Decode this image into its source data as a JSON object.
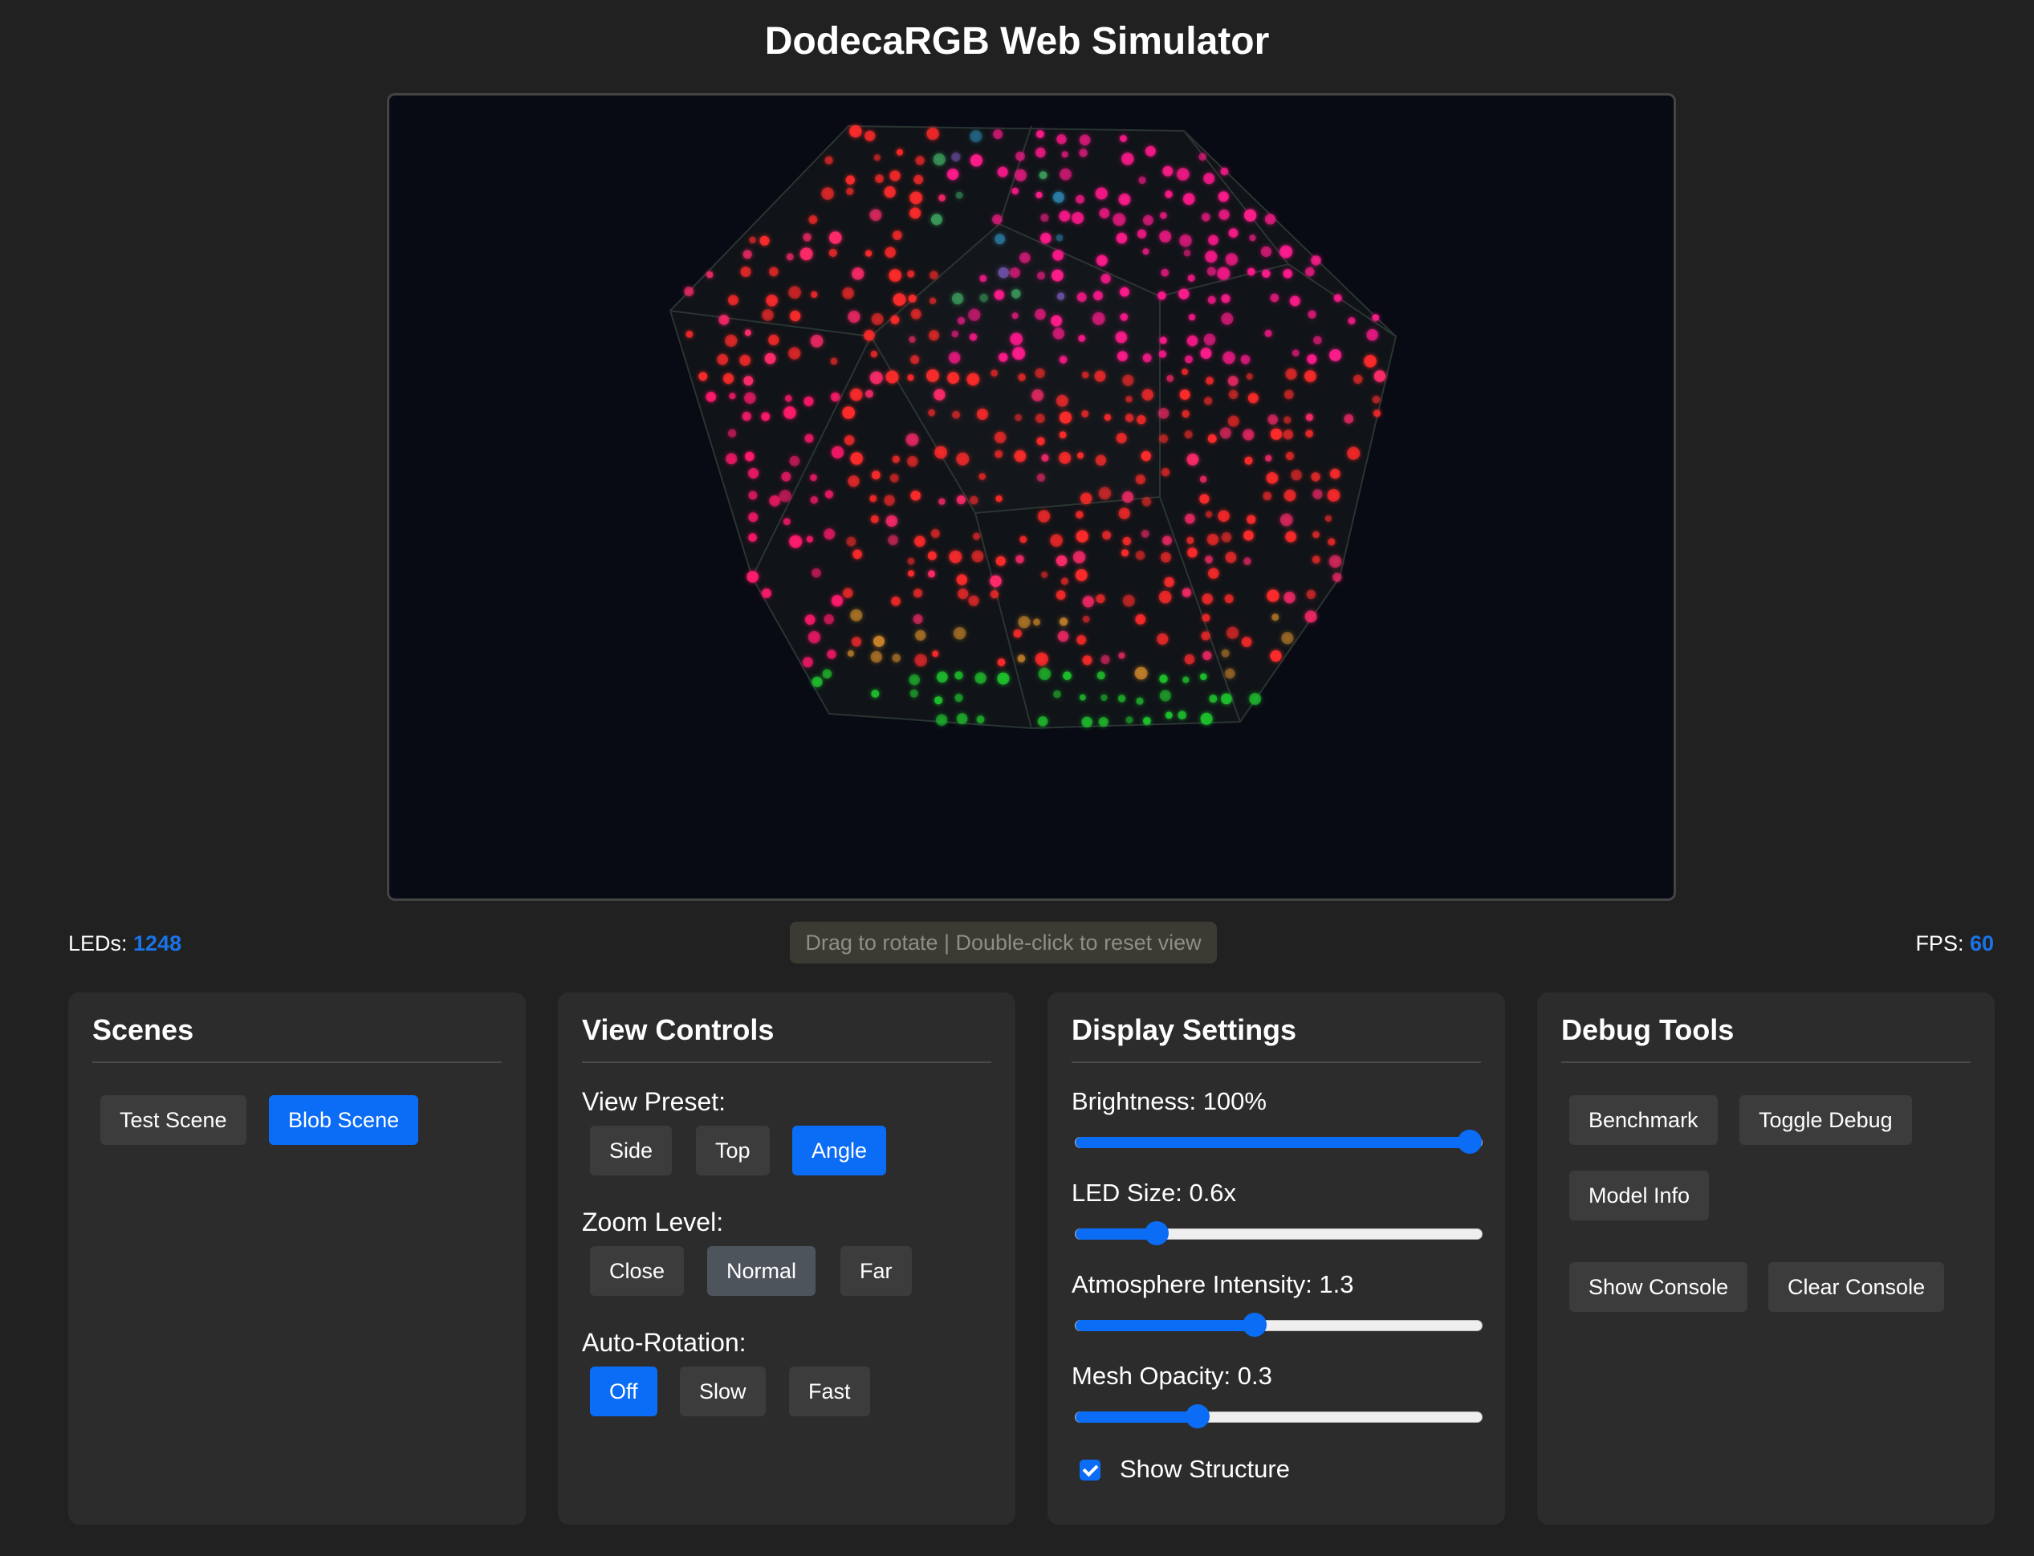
{
  "app": {
    "title": "DodecaRGB Web Simulator"
  },
  "stats": {
    "leds_label": "LEDs: ",
    "leds_value": "1248",
    "fps_label": "FPS: ",
    "fps_value": "60",
    "hint": "Drag to rotate | Double-click to reset view"
  },
  "colors": {
    "accent": "#0b6cf5",
    "stat_value": "#1a73e8",
    "page_bg": "#212121",
    "panel_bg": "#2c2c2c",
    "viewport_bg": "#080a14"
  },
  "scenes": {
    "title": "Scenes",
    "buttons": [
      {
        "label": "Test Scene",
        "active": false
      },
      {
        "label": "Blob Scene",
        "active": true
      }
    ]
  },
  "view_controls": {
    "title": "View Controls",
    "preset_label": "View Preset:",
    "presets": [
      {
        "label": "Side",
        "active": false
      },
      {
        "label": "Top",
        "active": false
      },
      {
        "label": "Angle",
        "active": true
      }
    ],
    "zoom_label": "Zoom Level:",
    "zoom": [
      {
        "label": "Close",
        "active": false
      },
      {
        "label": "Normal",
        "selected": true
      },
      {
        "label": "Far",
        "active": false
      }
    ],
    "rotation_label": "Auto-Rotation:",
    "rotation": [
      {
        "label": "Off",
        "active": true
      },
      {
        "label": "Slow",
        "active": false
      },
      {
        "label": "Fast",
        "active": false
      }
    ]
  },
  "display_settings": {
    "title": "Display Settings",
    "brightness": {
      "label": "Brightness: 100%",
      "value": 1.0
    },
    "led_size": {
      "label": "LED Size: 0.6x",
      "value": 0.2
    },
    "atmosphere": {
      "label": "Atmosphere Intensity: 1.3",
      "value": 0.44
    },
    "mesh_opacity": {
      "label": "Mesh Opacity: 0.3",
      "value": 0.3
    },
    "show_structure": {
      "label": "Show Structure",
      "checked": true
    }
  },
  "debug_tools": {
    "title": "Debug Tools",
    "buttons": [
      "Benchmark",
      "Toggle Debug",
      "Model Info"
    ],
    "console_buttons": [
      "Show Console",
      "Clear Console"
    ]
  }
}
